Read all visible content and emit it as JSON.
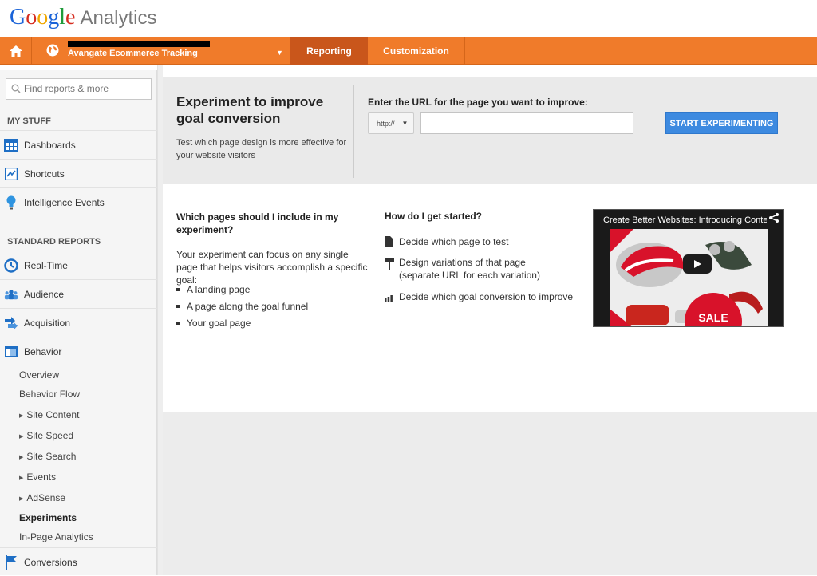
{
  "brand": {
    "logo_g1": "G",
    "logo_o1": "o",
    "logo_o2": "o",
    "logo_g2": "g",
    "logo_l": "l",
    "logo_e": "e",
    "product": "Analytics"
  },
  "nav": {
    "account_name": "Avangate Ecommerce Tracking",
    "reporting_label": "Reporting",
    "customization_label": "Customization",
    "accent_color": "#f07b2a"
  },
  "sidebar": {
    "search_placeholder": "Find reports & more",
    "my_stuff_title": "MY STUFF",
    "my_stuff": [
      {
        "label": "Dashboards",
        "icon": "dashboards-icon"
      },
      {
        "label": "Shortcuts",
        "icon": "shortcuts-icon"
      },
      {
        "label": "Intelligence Events",
        "icon": "lightbulb-icon"
      }
    ],
    "standard_title": "STANDARD REPORTS",
    "standard": [
      {
        "label": "Real-Time",
        "icon": "realtime-icon"
      },
      {
        "label": "Audience",
        "icon": "audience-icon"
      },
      {
        "label": "Acquisition",
        "icon": "acquisition-icon"
      },
      {
        "label": "Behavior",
        "icon": "behavior-icon"
      }
    ],
    "behavior_sub": [
      {
        "label": "Overview"
      },
      {
        "label": "Behavior Flow"
      },
      {
        "label": "Site Content"
      },
      {
        "label": "Site Speed"
      },
      {
        "label": "Site Search"
      },
      {
        "label": "Events"
      },
      {
        "label": "AdSense"
      },
      {
        "label": "Experiments"
      },
      {
        "label": "In-Page Analytics"
      }
    ],
    "conversions_label": "Conversions"
  },
  "hero": {
    "title": "Experiment to improve goal conversion",
    "description": "Test which page design is more effective for your website visitors",
    "url_label": "Enter the URL for the page you want to improve:",
    "protocol_value": "http://",
    "url_value": "",
    "start_button": "START EXPERIMENTING"
  },
  "content": {
    "pages_title": "Which pages should I include in my experiment?",
    "pages_desc": "Your experiment can focus on any single page that helps visitors accomplish a specific goal:",
    "bullets": [
      "A landing page",
      "A page along the goal funnel",
      "Your goal page"
    ],
    "start_title": "How do I get started?",
    "steps": [
      {
        "line1": "Decide which page to test",
        "line2": "",
        "icon": "document-icon"
      },
      {
        "line1": "Design variations of that page",
        "line2": "(separate URL for each variation)",
        "icon": "paint-roller-icon"
      },
      {
        "line1": "Decide which goal conversion to improve",
        "line2": "",
        "icon": "bar-chart-icon"
      }
    ],
    "video_title": "Create Better Websites: Introducing Conten",
    "video_badge": "SALE"
  }
}
